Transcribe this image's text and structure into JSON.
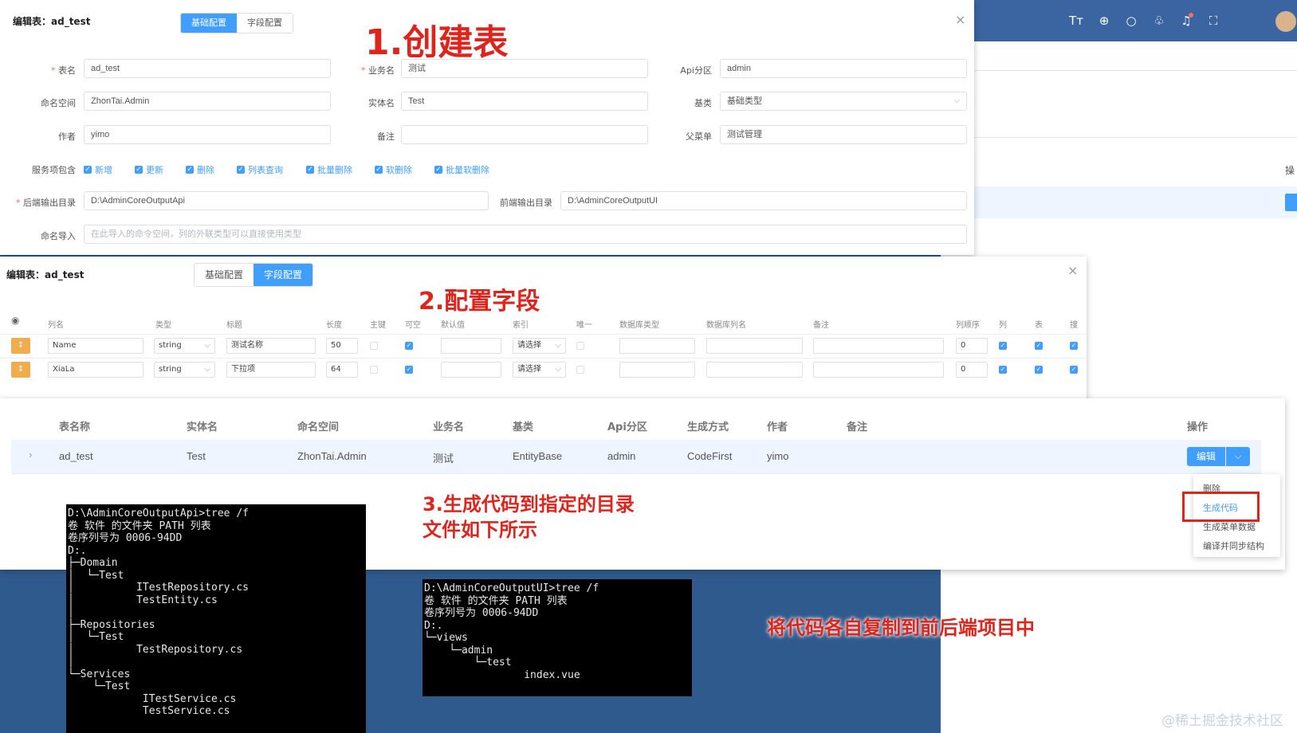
{
  "header_icons": [
    "font-size-icon",
    "globe-icon",
    "search-icon",
    "shirt-icon",
    "bell-icon",
    "fullscreen-icon"
  ],
  "bg_right_partial": {
    "text": "操"
  },
  "dialog1": {
    "title": "编辑表：ad_test",
    "tabs": [
      "基础配置",
      "字段配置"
    ],
    "labels": {
      "table_name": "表名",
      "business_name": "业务名",
      "api_area": "Api分区",
      "namespace": "命名空间",
      "entity_name": "实体名",
      "base_class": "基类",
      "author": "作者",
      "remark": "备注",
      "parent_menu": "父菜单",
      "service_include": "服务项包含",
      "backend_dir": "后端输出目录",
      "frontend_dir": "前端输出目录",
      "ns_import": "命名导入"
    },
    "values": {
      "table_name": "ad_test",
      "business_name": "测试",
      "api_area": "admin",
      "namespace": "ZhonTai.Admin",
      "entity_name": "Test",
      "base_class": "基础类型",
      "author": "yimo",
      "remark": "",
      "parent_menu": "测试管理",
      "backend_dir": "D:\\AdminCoreOutputApi",
      "frontend_dir": "D:\\AdminCoreOutputUI"
    },
    "ns_import_placeholder": "在此导入的命令空间，列的外联类型可以直接使用类型",
    "services": [
      "新增",
      "更新",
      "删除",
      "列表查询",
      "批量删除",
      "软删除",
      "批量软删除"
    ]
  },
  "dialog2": {
    "title": "编辑表：ad_test",
    "tabs": [
      "基础配置",
      "字段配置"
    ],
    "headers": [
      "列名",
      "类型",
      "标题",
      "长度",
      "主键",
      "可空",
      "默认值",
      "索引",
      "唯一",
      "数据库类型",
      "数据库列名",
      "备注",
      "列顺序",
      "列",
      "表",
      "搜"
    ],
    "rows": [
      {
        "name": "Name",
        "type": "string",
        "title": "测试名称",
        "length": "50",
        "index": "请选择",
        "order": "0"
      },
      {
        "name": "XiaLa",
        "type": "string",
        "title": "下拉项",
        "length": "64",
        "index": "请选择",
        "order": "0"
      }
    ]
  },
  "table": {
    "headers": [
      "表名称",
      "实体名",
      "命名空间",
      "业务名",
      "基类",
      "Api分区",
      "生成方式",
      "作者",
      "备注",
      "操作"
    ],
    "row": {
      "table_name": "ad_test",
      "entity": "Test",
      "namespace": "ZhonTai.Admin",
      "business": "测试",
      "base": "EntityBase",
      "api": "admin",
      "gen": "CodeFirst",
      "author": "yimo",
      "remark": ""
    },
    "edit_button": "编辑",
    "menu": [
      "删除",
      "生成代码",
      "生成菜单数据",
      "编译并同步结构"
    ]
  },
  "annotations": {
    "step1": "1.创建表",
    "step2": "2.配置字段",
    "step3_line1": "3.生成代码到指定的目录",
    "step3_line2": "文件如下所示",
    "step4": "将代码各自复制到前后端项目中"
  },
  "terminal_api": [
    "D:\\AdminCoreOutputApi>tree /f",
    "卷 软件 的文件夹 PATH 列表",
    "卷序列号为 0006-94DD",
    "D:.",
    "├─Domain",
    "│  └─Test",
    "│          ITestRepository.cs",
    "│          TestEntity.cs",
    "│",
    "├─Repositories",
    "│  └─Test",
    "│          TestRepository.cs",
    "│",
    "└─Services",
    "    └─Test",
    "            ITestService.cs",
    "            TestService.cs"
  ],
  "terminal_ui": [
    "D:\\AdminCoreOutputUI>tree /f",
    "卷 软件 的文件夹 PATH 列表",
    "卷序列号为 0006-94DD",
    "D:.",
    "└─views",
    "    └─admin",
    "        └─test",
    "                index.vue"
  ],
  "watermark": "@稀土掘金技术社区"
}
